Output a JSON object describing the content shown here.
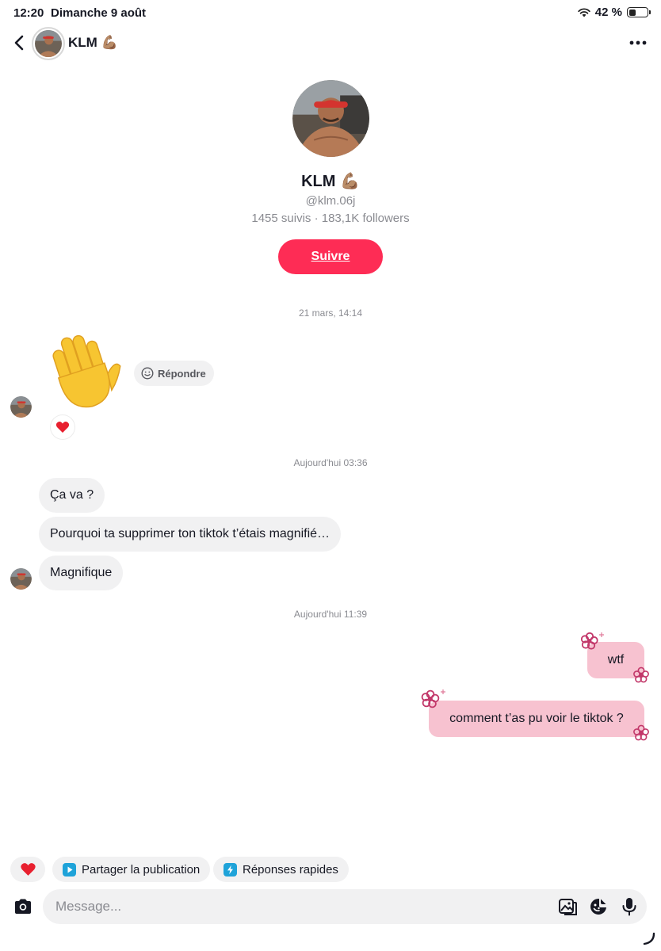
{
  "status_bar": {
    "time": "12:20",
    "date": "Dimanche 9 août",
    "battery": "42 %",
    "battery_level": 0.42
  },
  "header": {
    "name": "KLM 💪🏽"
  },
  "profile": {
    "name": "KLM 💪🏽",
    "handle": "@klm.06j",
    "stats": "1455 suivis · 183,1K followers",
    "follow_label": "Suivre"
  },
  "conversation": {
    "timestamps": [
      "21 mars, 14:14",
      "Aujourd'hui 03:36",
      "Aujourd'hui 11:39"
    ],
    "reply_label": "Répondre",
    "incoming": [
      "Ça va ?",
      "Pourquoi ta supprimer ton tiktok t’étais magnifié…",
      "Magnifique"
    ],
    "outgoing": [
      "wtf",
      "comment t’as pu voir le tiktok ?"
    ]
  },
  "quick_actions": {
    "share_label": "Partager la publication",
    "quick_replies_label": "Réponses rapides"
  },
  "composer": {
    "placeholder": "Message..."
  },
  "colors": {
    "accent": "#fe2c55",
    "outgoing_bubble": "#f7c2d0",
    "flower": "#c2386a"
  }
}
